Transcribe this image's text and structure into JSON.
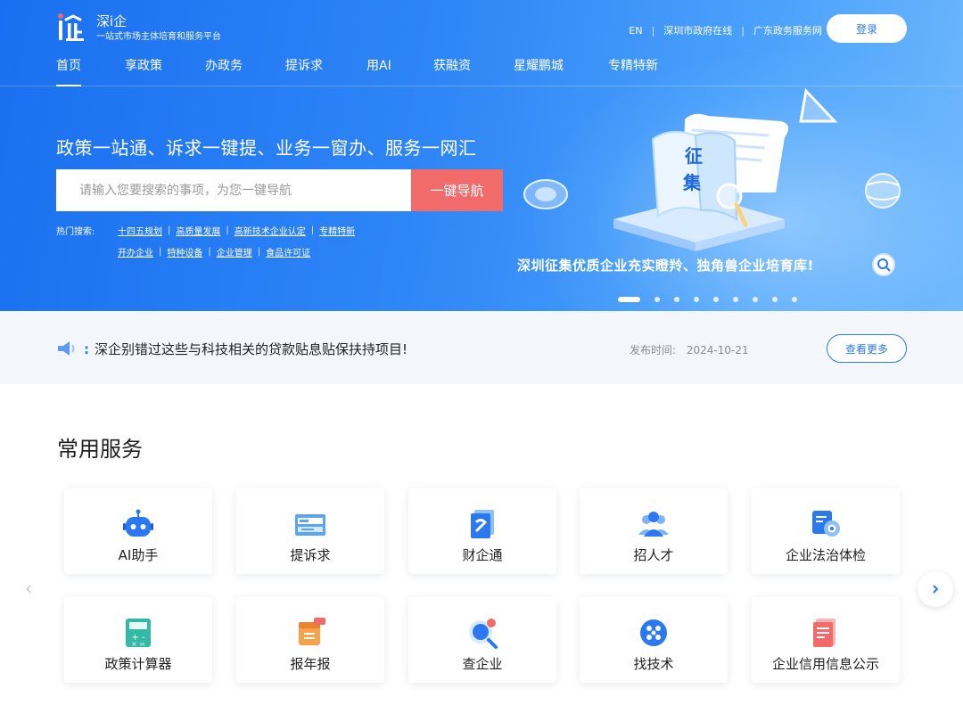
{
  "header": {
    "logo_name": "深i企",
    "logo_sub": "一站式市场主体培育和服务平台",
    "links": [
      "EN",
      "深圳市政府在线",
      "广东政务服务网"
    ],
    "login_label": "登录"
  },
  "nav": {
    "items": [
      "首页",
      "享政策",
      "办政务",
      "提诉求",
      "用AI",
      "获融资",
      "星耀鹏城",
      "专精特新"
    ]
  },
  "hero": {
    "slogan": "政策一站通、诉求一键提、业务一窗办、服务一网汇",
    "search_placeholder": "请输入您要搜索的事项，为您一键导航",
    "search_button": "一键导航",
    "hot_label": "热门搜索:",
    "hot_row1": [
      "十四五规划",
      "高质量发展",
      "高新技术企业认定",
      "专精特新"
    ],
    "hot_row2": [
      "开办企业",
      "特种设备",
      "企业管理",
      "食品许可证"
    ],
    "banner_badge_top": "征",
    "banner_badge_bottom": "集",
    "banner_caption": "深圳征集优质企业充实瞪羚、独角兽企业培育库!",
    "carousel_total": 9,
    "carousel_active": 1
  },
  "notice": {
    "text": "深企别错过这些与科技相关的贷款贴息贴保扶持项目!",
    "time_label": "发布时间:",
    "time_value": "2024-10-21",
    "more_label": "查看更多"
  },
  "services": {
    "title": "常用服务",
    "row1": [
      {
        "label": "AI助手",
        "icon": "robot-icon"
      },
      {
        "label": "提诉求",
        "icon": "appeal-board-icon"
      },
      {
        "label": "财企通",
        "icon": "finance-doc-icon"
      },
      {
        "label": "招人才",
        "icon": "people-icon"
      },
      {
        "label": "企业法治体检",
        "icon": "shield-gear-icon"
      }
    ],
    "row2": [
      {
        "label": "政策计算器",
        "icon": "calculator-icon"
      },
      {
        "label": "报年报",
        "icon": "annual-report-icon"
      },
      {
        "label": "查企业",
        "icon": "search-company-icon"
      },
      {
        "label": "找技术",
        "icon": "tech-dots-icon"
      },
      {
        "label": "企业信用信息公示",
        "icon": "credit-doc-icon"
      }
    ]
  },
  "colors": {
    "brand_blue": "#2b78f0",
    "search_button": "#f26b6b",
    "notice_bg": "#f3f7fc"
  }
}
